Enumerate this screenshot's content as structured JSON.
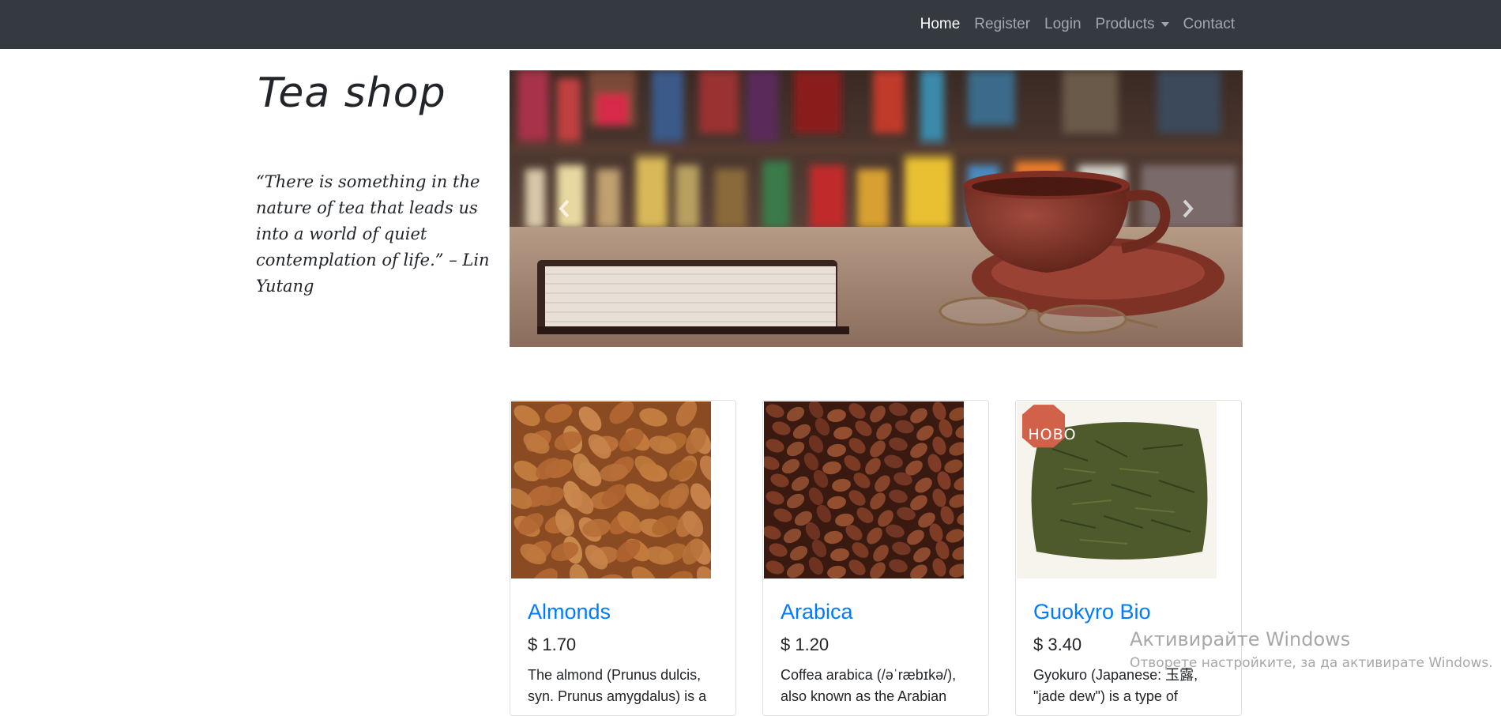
{
  "nav": {
    "items": [
      {
        "label": "Home",
        "active": true
      },
      {
        "label": "Register"
      },
      {
        "label": "Login"
      },
      {
        "label": "Products",
        "dropdown": true
      },
      {
        "label": "Contact"
      }
    ]
  },
  "hero": {
    "brand": "Tea shop",
    "quote": "“There is something in the nature of tea that leads us into a world of quiet contemplation of life.” – Lin Yutang"
  },
  "carousel": {
    "prev_icon": "chevron-left-icon",
    "next_icon": "chevron-right-icon"
  },
  "products": [
    {
      "title": "Almonds",
      "price": "$ 1.70",
      "desc": "The almond (Prunus dulcis, syn. Prunus amygdalus) is a"
    },
    {
      "title": "Arabica",
      "price": "$ 1.20",
      "desc": "Coffea arabica (/əˈræbɪkə/), also known as the Arabian"
    },
    {
      "title": "Guokyro Bio",
      "price": "$ 3.40",
      "desc": "Gyokuro (Japanese: 玉露, \"jade dew\") is a type of",
      "badge": "НОВО"
    }
  ],
  "watermark": {
    "line1": "Активирайте Windows",
    "line2": "Отворете настройките, за да активирате Windows."
  },
  "colors": {
    "navbar": "#343a40",
    "link": "#007bff",
    "badge": "#d2614a"
  }
}
